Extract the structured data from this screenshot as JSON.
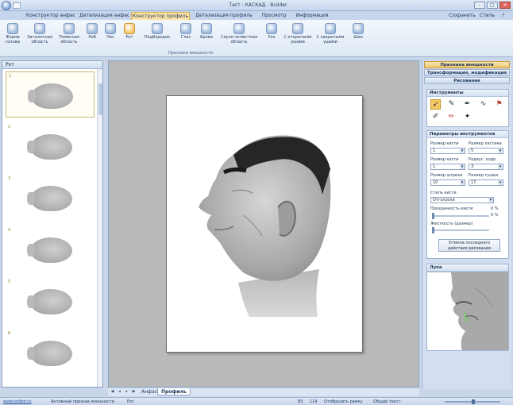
{
  "window": {
    "title": "Тест - КАСКАД - Builder"
  },
  "tabs": [
    {
      "label": "Конструктор анфас",
      "active": false
    },
    {
      "label": "Детализация анфас",
      "active": false
    },
    {
      "label": "Конструктор профиль",
      "active": true
    },
    {
      "label": "Детализация профиль",
      "active": false
    },
    {
      "label": "Просмотр",
      "active": false
    },
    {
      "label": "Информация",
      "active": false
    }
  ],
  "tabs_right": {
    "save": "Сохранить",
    "style": "Стиль"
  },
  "ribbon": {
    "buttons": [
      "Форма головы",
      "Затылочная область",
      "Теменная область",
      "Лоб",
      "Нос",
      "Рот",
      "Подбородок",
      "Глаз",
      "Брови",
      "Скуло-челюстная область",
      "Ухо",
      "С открытыми ушами",
      "С закрытыми ушами",
      "Шея"
    ],
    "selected_index": 5,
    "group_label": "Признаки внешности"
  },
  "thumbnails": {
    "header": "Рот",
    "items": [
      "1",
      "2",
      "3",
      "4",
      "5",
      "6"
    ],
    "selected_index": 0
  },
  "sheets": {
    "tabs": [
      "Анфас",
      "Профиль"
    ],
    "active_index": 1
  },
  "right_panel": {
    "header_gold": "Признаки внешности",
    "header_2": "Трансформация, модификация",
    "header_3": "Рисование",
    "tools_title": "Инструменты",
    "params_title": "Параметры инструментов",
    "brush_size_label": "Размер кисти",
    "brush_size": "1",
    "eraser_size_label": "Размер ластика",
    "eraser_size": "5",
    "pen_size_label": "Размер кисти",
    "pen_size": "1",
    "blur_radius_label": "Радиус. корр.",
    "blur_radius": "3",
    "stroke_size_label": "Размер штриха",
    "stroke_size": "10",
    "stroke_width_label": "Размер тушки",
    "stroke_width": "17",
    "brush_style_label": "Стиль кисти",
    "brush_style": "Отголоски",
    "opacity_label": "Прозрачность кисти",
    "opacity_value": "0 %",
    "hardness_value": "0 %",
    "contrast_label": "Жесткость (размер)",
    "undo_button": "Отмена последнего действия рисования",
    "magnifier_title": "Лупа"
  },
  "status": {
    "link": "www.kodbd.ru",
    "left": "Активный признак внешности",
    "left_value": "Рот",
    "coords_a": "83",
    "coords_b": "114",
    "mode": "Отобразить рамку",
    "layer": "Общий текст"
  }
}
